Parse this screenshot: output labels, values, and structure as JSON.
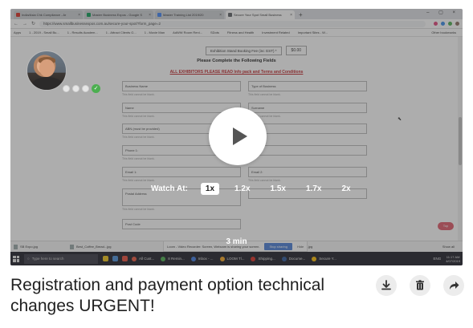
{
  "browser": {
    "tabs": [
      {
        "label": "India/Asia Chk Compliance - Ar",
        "color": "#d93025",
        "active": false
      },
      {
        "label": "Master Business Expos - Google S",
        "color": "#0f9d58",
        "active": false
      },
      {
        "label": "Master Training List 2019/20",
        "color": "#4285f4",
        "active": false
      },
      {
        "label": "Secure Your Spot Small Business",
        "color": "#5f6368",
        "active": true
      }
    ],
    "new_tab": "+",
    "url": "https://www.smallbusinessexpos.com.au/secure-your-spot/?form_page=2",
    "bookmarks": [
      "Apps",
      "1 - 2019 - Small Bu...",
      "1 - Results Academ...",
      "1 - Attract Clients G...",
      "1 - Movie Man",
      "AdWW Room Reni...",
      "SDots",
      "Fitness and Health",
      "Investment Related",
      "Important Sites - W..."
    ],
    "bookmarks_other": "Other bookmarks"
  },
  "page": {
    "fee_label": "Exhibition Stand Booking Fee (inc GST) *",
    "fee_value": "$0.00",
    "form_title": "Please Complete the Following Fields",
    "warning": "ALL EXHIBITORS PLEASE READ Info pack and Terms and Conditions",
    "fields_left": [
      "Business Name",
      "Name",
      "ABN (must be provided)",
      "Phone 1:",
      "Email 1:",
      "Postal Address",
      "Post Code"
    ],
    "fields_right": [
      "Type of Business",
      "Surname",
      "",
      "",
      "Email 2:",
      ""
    ],
    "field_error": "This field cannot be blank.",
    "bottom_button": "Top"
  },
  "downloads": {
    "items": [
      "SB Expo.jpg",
      "Best_Coffee_Bread...jpg",
      "25790332.jpg"
    ],
    "show_all": "Show all",
    "notification": "Loom - Video Recorder: Screen, Webcam is sharing your screen.",
    "notification_button": "Stop sharing",
    "notification_hide": "Hide"
  },
  "taskbar": {
    "search": "Type here to search",
    "apps": [
      "All Cust...",
      "8 Remin...",
      "Inbox - ...",
      "LOOM Tl...",
      "Shipping...",
      "Docume...",
      "Secure Y..."
    ],
    "lang": "ENG",
    "time": "11:17 AM",
    "date": "4/07/2019"
  },
  "player": {
    "watch_at_label": "Watch At:",
    "speeds": [
      "1x",
      "1.2x",
      "1.5x",
      "1.7x",
      "2x"
    ],
    "selected_speed": "1x",
    "duration": "3 min"
  },
  "video_title": "Registration and payment option technical changes URGENT!",
  "actions": {
    "download": "download-icon",
    "delete": "trash-icon",
    "share": "share-icon"
  }
}
